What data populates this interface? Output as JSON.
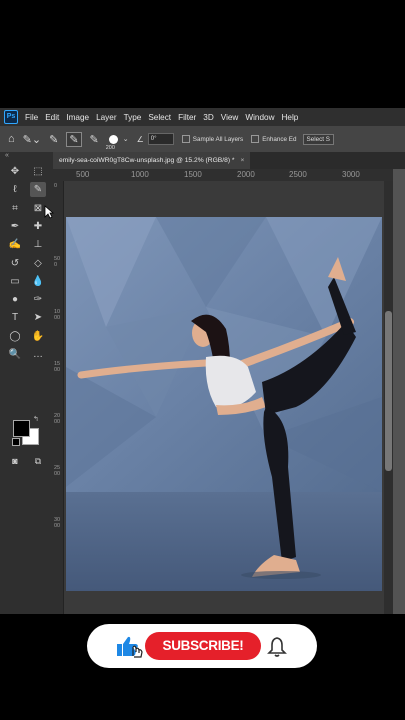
{
  "app": {
    "logo": "Ps",
    "menu": [
      "File",
      "Edit",
      "Image",
      "Layer",
      "Type",
      "Select",
      "Filter",
      "3D",
      "View",
      "Window",
      "Help"
    ]
  },
  "options_bar": {
    "brush_size": "200",
    "angle": "0°",
    "sample_all_layers": "Sample All Layers",
    "enhance_edge": "Enhance Ed",
    "select_button": "Select S"
  },
  "document": {
    "tab_title": "emily-sea-coiWR0gT8Cw-unsplash.jpg @ 15.2% (RGB/8) *",
    "tab_close": "×",
    "h_ruler": [
      "500",
      "1000",
      "1500",
      "2000",
      "2500",
      "3000"
    ],
    "v_ruler": [
      "0",
      "500",
      "1000",
      "1500",
      "2000",
      "2500",
      "3000"
    ]
  },
  "toolbar": {
    "collapse": "«",
    "tools": [
      {
        "name": "move-tool-icon",
        "glyph": "✥"
      },
      {
        "name": "marquee-tool-icon",
        "glyph": "⬚"
      },
      {
        "name": "lasso-tool-icon",
        "glyph": "ℓ"
      },
      {
        "name": "quick-selection-tool-icon",
        "glyph": "✎"
      },
      {
        "name": "crop-tool-icon",
        "glyph": "⌗"
      },
      {
        "name": "frame-tool-icon",
        "glyph": "⊠"
      },
      {
        "name": "eyedropper-tool-icon",
        "glyph": "✒"
      },
      {
        "name": "spot-healing-tool-icon",
        "glyph": "✚"
      },
      {
        "name": "brush-tool-icon",
        "glyph": "✍"
      },
      {
        "name": "stamp-tool-icon",
        "glyph": "⊥"
      },
      {
        "name": "history-brush-tool-icon",
        "glyph": "↺"
      },
      {
        "name": "eraser-tool-icon",
        "glyph": "◇"
      },
      {
        "name": "gradient-tool-icon",
        "glyph": "▭"
      },
      {
        "name": "blur-tool-icon",
        "glyph": "💧"
      },
      {
        "name": "dodge-tool-icon",
        "glyph": "●"
      },
      {
        "name": "pen-tool-icon",
        "glyph": "✑"
      },
      {
        "name": "type-tool-icon",
        "glyph": "T"
      },
      {
        "name": "path-selection-tool-icon",
        "glyph": "➤"
      },
      {
        "name": "shape-tool-icon",
        "glyph": "◯"
      },
      {
        "name": "hand-tool-icon",
        "glyph": "✋"
      },
      {
        "name": "zoom-tool-icon",
        "glyph": "🔍"
      },
      {
        "name": "more-tools-icon",
        "glyph": "…"
      }
    ]
  },
  "overlay": {
    "subscribe_label": "SUBSCRIBE!"
  },
  "colors": {
    "subscribe_red": "#e5202a",
    "like_blue": "#1e88e5",
    "ps_blue": "#31a8ff"
  }
}
